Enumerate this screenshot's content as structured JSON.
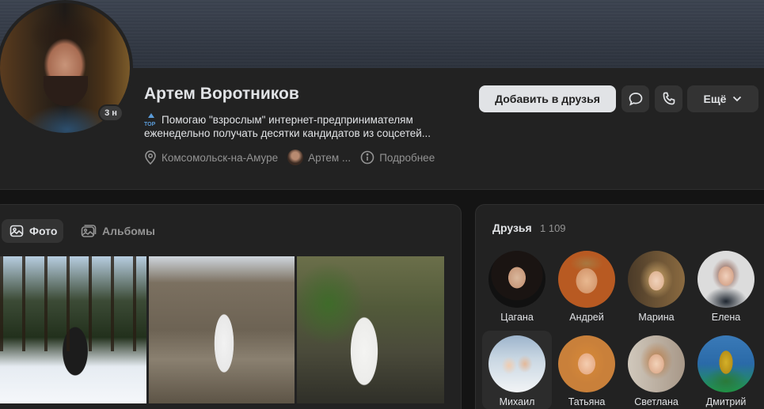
{
  "profile": {
    "name": "Артем Воротников",
    "online_badge": "3 н",
    "status_emoji": "TOP",
    "status_line1": "Помогаю \"взрослым\" интернет-предпринимателям",
    "status_line2": "еженедельно получать десятки кандидатов из соцсетей...",
    "location": "Комсомольск-на-Амуре",
    "linked_name": "Артем ...",
    "more_info": "Подробнее"
  },
  "actions": {
    "add_friend": "Добавить в друзья",
    "more": "Ещё",
    "icons": [
      "message-icon",
      "phone-icon",
      "chevron-down-icon"
    ]
  },
  "photos": {
    "tabs": [
      {
        "label": "Фото",
        "active": true
      },
      {
        "label": "Альбомы",
        "active": false
      }
    ]
  },
  "friends": {
    "title": "Друзья",
    "count": "1 109",
    "items": [
      {
        "name": "Цагана"
      },
      {
        "name": "Андрей"
      },
      {
        "name": "Марина"
      },
      {
        "name": "Елена"
      },
      {
        "name": "Михаил"
      },
      {
        "name": "Татьяна"
      },
      {
        "name": "Светлана"
      },
      {
        "name": "Дмитрий"
      }
    ]
  },
  "colors": {
    "background": "#141414",
    "card": "#222222",
    "primary_button": "#e1e3e6",
    "secondary_button": "#333333",
    "muted_text": "#939393"
  }
}
